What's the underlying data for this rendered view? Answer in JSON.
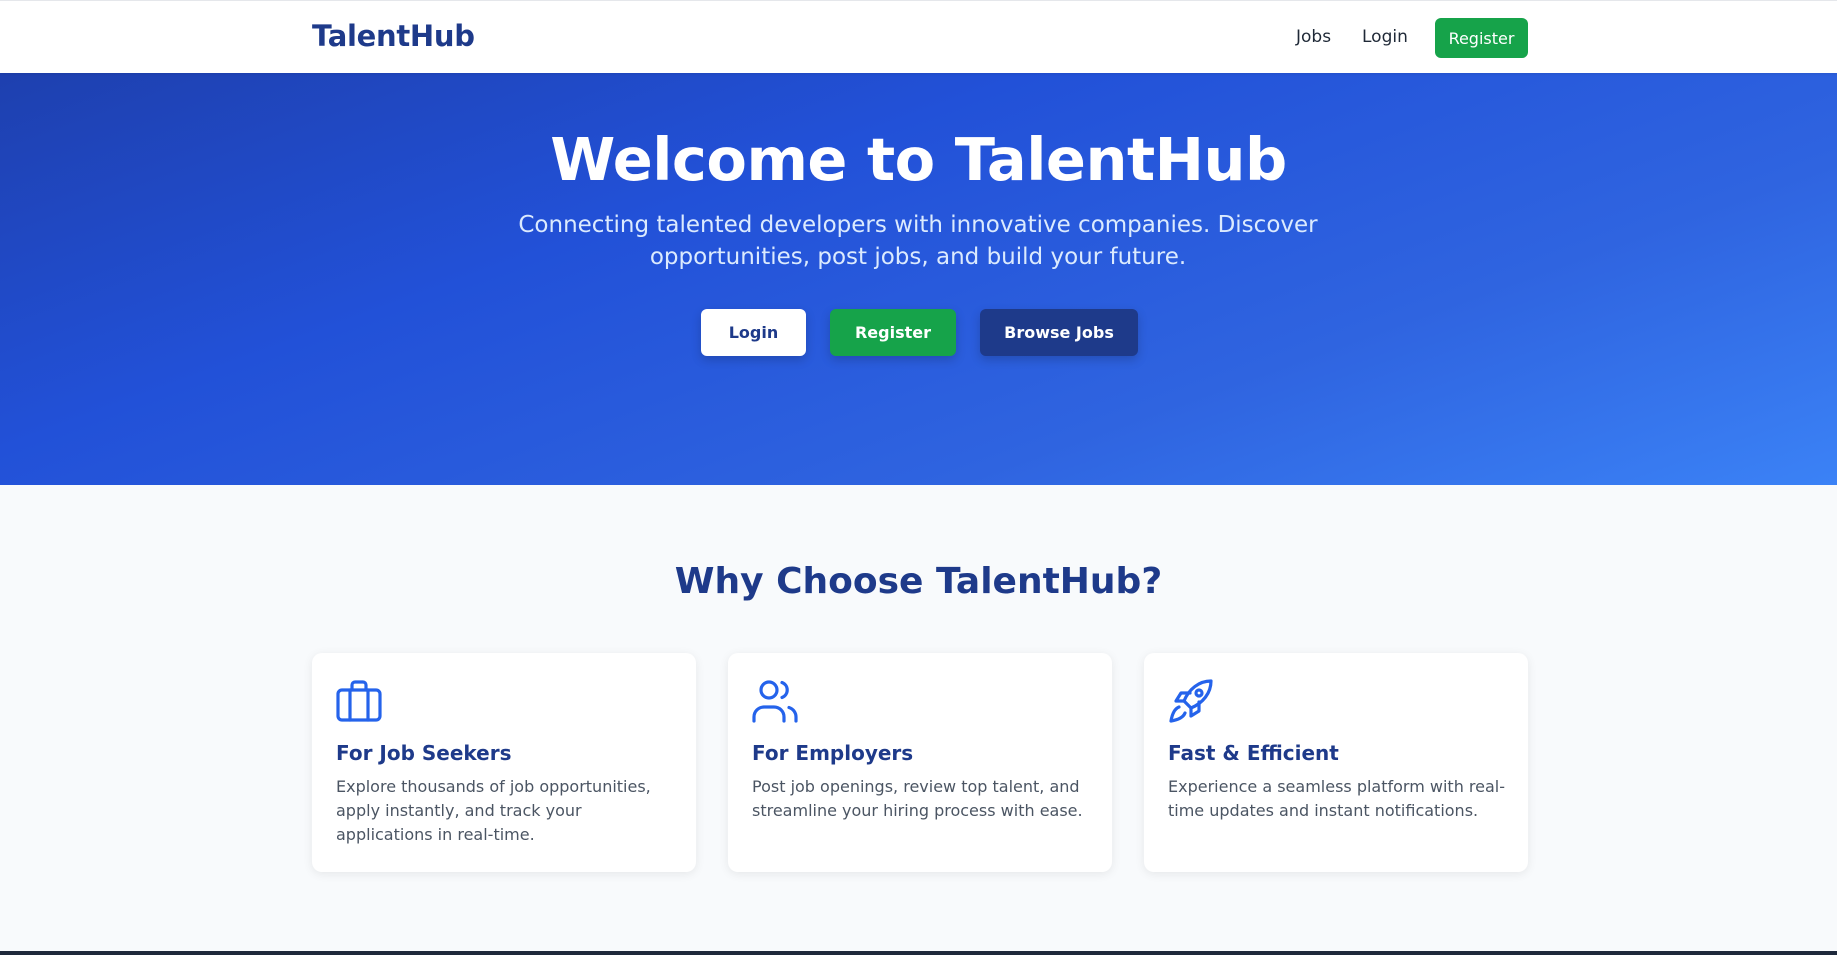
{
  "navbar": {
    "brand": "TalentHub",
    "links": {
      "jobs": "Jobs",
      "login": "Login"
    },
    "register_label": "Register"
  },
  "hero": {
    "title": "Welcome to TalentHub",
    "subtitle": "Connecting talented developers with innovative companies. Discover opportunities, post jobs, and build your future.",
    "buttons": {
      "login": "Login",
      "register": "Register",
      "browse": "Browse Jobs"
    }
  },
  "features": {
    "heading": "Why Choose TalentHub?",
    "cards": [
      {
        "icon": "briefcase-icon",
        "title": "For Job Seekers",
        "text": "Explore thousands of job opportunities, apply instantly, and track your applications in real-time."
      },
      {
        "icon": "users-icon",
        "title": "For Employers",
        "text": "Post job openings, review top talent, and streamline your hiring process with ease."
      },
      {
        "icon": "rocket-icon",
        "title": "Fast & Efficient",
        "text": "Experience a seamless platform with real-time updates and instant notifications."
      }
    ]
  },
  "colors": {
    "primary": "#1e3a8a",
    "accent_blue": "#2563eb",
    "success": "#16a34a",
    "background": "#f8fafc"
  }
}
